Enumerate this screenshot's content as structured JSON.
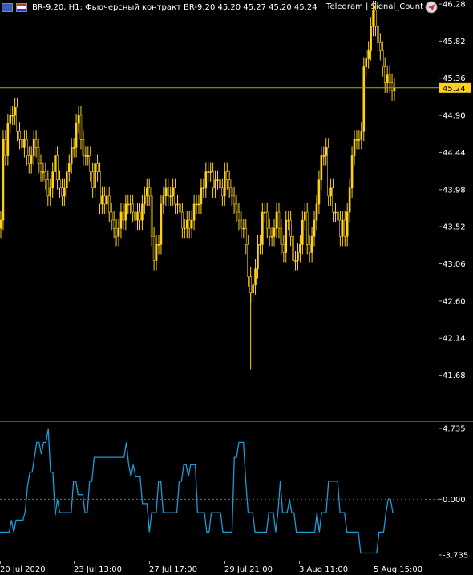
{
  "header": {
    "symbol_text": "BR-9.20, H1:  Фьючерсный контракт BR-9.20  45.20 45.27 45.20 45.24",
    "indicator_label": "Telegram | Signal_Count",
    "current_price_label": "45.24",
    "current_price": 45.24
  },
  "colors": {
    "background": "#000000",
    "candle": "#ffd21a",
    "price_line": "#c8a000",
    "price_tag_bg": "#ffd21a",
    "indicator": "#1e9ad6",
    "axis_text": "#ffffff",
    "zero_line": "#6e6e6e"
  },
  "chart_data": [
    {
      "type": "candlestick",
      "title": "BR-9.20, H1",
      "y_ticks": [
        "46.28",
        "45.82",
        "45.36",
        "44.90",
        "44.44",
        "43.98",
        "43.52",
        "43.06",
        "42.60",
        "42.14",
        "41.68"
      ],
      "ylim": [
        41.15,
        46.28
      ],
      "close": [
        43.6,
        44.6,
        44.4,
        44.8,
        44.9,
        44.9,
        45.0,
        44.7,
        44.6,
        44.5,
        44.6,
        44.4,
        44.3,
        44.4,
        44.6,
        44.5,
        44.3,
        44.2,
        44.2,
        44.1,
        43.9,
        44.0,
        44.2,
        44.4,
        44.1,
        44.0,
        43.9,
        44.0,
        44.2,
        44.3,
        44.5,
        44.5,
        44.8,
        44.9,
        44.6,
        44.4,
        44.4,
        44.4,
        44.2,
        44.0,
        44.3,
        44.2,
        43.8,
        43.9,
        43.8,
        43.9,
        43.7,
        43.6,
        43.5,
        43.4,
        43.5,
        43.7,
        43.6,
        43.8,
        43.8,
        43.8,
        43.7,
        43.6,
        43.7,
        43.6,
        43.8,
        43.9,
        44.0,
        43.9,
        43.4,
        43.1,
        43.3,
        43.3,
        43.8,
        43.9,
        44.0,
        43.9,
        43.9,
        44.0,
        43.8,
        43.8,
        43.7,
        43.5,
        43.5,
        43.6,
        43.5,
        43.6,
        43.8,
        43.8,
        43.8,
        44.0,
        44.0,
        44.2,
        44.2,
        44.2,
        44.0,
        44.1,
        44.1,
        44.0,
        43.9,
        44.2,
        44.1,
        44.0,
        43.9,
        43.8,
        43.7,
        43.6,
        43.5,
        43.5,
        43.3,
        42.9,
        42.7,
        42.8,
        43.0,
        43.3,
        43.3,
        43.7,
        43.7,
        43.5,
        43.4,
        43.4,
        43.5,
        43.7,
        43.5,
        43.3,
        43.2,
        43.6,
        43.6,
        43.4,
        43.1,
        43.1,
        43.2,
        43.3,
        43.6,
        43.7,
        43.3,
        43.2,
        43.4,
        43.6,
        43.8,
        44.1,
        44.4,
        44.4,
        44.5,
        43.9,
        44.0,
        43.7,
        43.7,
        43.6,
        43.4,
        43.6,
        43.4,
        43.7,
        44.0,
        44.4,
        44.6,
        44.6,
        44.6,
        44.7,
        45.5,
        45.6,
        45.7,
        46.0,
        46.2,
        46.0,
        45.8,
        45.7,
        45.5,
        45.3,
        45.4,
        45.3,
        45.2,
        45.24
      ],
      "time_ticks": [
        "20 Jul 2020",
        "23 Jul 13:00",
        "27 Jul 17:00",
        "29 Jul 21:00",
        "3 Aug 11:00",
        "5 Aug 15:00"
      ],
      "spikes": [
        {
          "bar": 106,
          "low": 41.75
        }
      ]
    },
    {
      "type": "line",
      "title": "Signal_Count",
      "y_ticks": [
        "4.735",
        "0.000",
        "-3.735"
      ],
      "ylim": [
        -3.735,
        4.735
      ],
      "values": [
        -2.2,
        -2.2,
        -2.2,
        -2.2,
        -2.2,
        -1.4,
        -2.2,
        -1.4,
        -1.4,
        -1.4,
        -1.4,
        -0.8,
        0.9,
        1.8,
        1.8,
        2.8,
        3.8,
        3.8,
        3.0,
        3.8,
        3.8,
        4.7,
        1.8,
        1.8,
        -1.1,
        0.0,
        -0.9,
        -0.9,
        -0.9,
        -0.9,
        -0.9,
        -0.9,
        1.2,
        1.2,
        0.3,
        0.3,
        0.3,
        -0.9,
        -0.9,
        1.2,
        1.2,
        2.8,
        2.8,
        2.8,
        2.8,
        2.8,
        2.8,
        2.8,
        2.8,
        2.8,
        2.8,
        2.8,
        2.8,
        2.8,
        2.8,
        3.8,
        2.3,
        1.5,
        2.3,
        1.5,
        1.5,
        1.5,
        -0.3,
        -0.3,
        -0.3,
        -2.2,
        -0.9,
        -0.9,
        -0.9,
        1.2,
        1.2,
        -0.9,
        -0.9,
        -0.9,
        -0.9,
        -0.9,
        -0.9,
        -0.9,
        1.2,
        1.2,
        2.3,
        2.3,
        1.5,
        2.3,
        2.3,
        2.3,
        -0.9,
        -0.9,
        -0.9,
        -0.9,
        -2.2,
        -2.2,
        -0.9,
        -0.9,
        -0.9,
        -0.9,
        -0.9,
        -2.2,
        -2.2,
        -2.2,
        -2.2,
        -2.2,
        2.8,
        2.8,
        3.8,
        3.8,
        3.8,
        1.2,
        -0.9,
        -0.9,
        -0.9,
        -2.2,
        -2.2,
        -2.2,
        -2.2,
        -2.2,
        -2.2,
        -0.9,
        -0.9,
        -0.9,
        -2.2,
        -0.9,
        1.2,
        -0.9,
        -0.9,
        -0.9,
        0.0,
        -0.9,
        -0.9,
        -2.2,
        -2.2,
        -2.2,
        -2.2,
        -2.2,
        -2.2,
        -2.2,
        -2.2,
        -2.2,
        -0.9,
        -2.2,
        -0.9,
        -0.9,
        -0.9,
        1.2,
        1.2,
        1.2,
        1.2,
        1.2,
        -0.9,
        -0.9,
        -0.9,
        -2.2,
        -2.2,
        -2.2,
        -2.2,
        -2.2,
        -2.2,
        -3.6,
        -3.6,
        -3.6,
        -3.6,
        -3.6,
        -3.6,
        -3.6,
        -3.6,
        -2.2,
        -2.2,
        -2.2,
        -0.9,
        0.0,
        0.0,
        -0.9
      ]
    }
  ]
}
